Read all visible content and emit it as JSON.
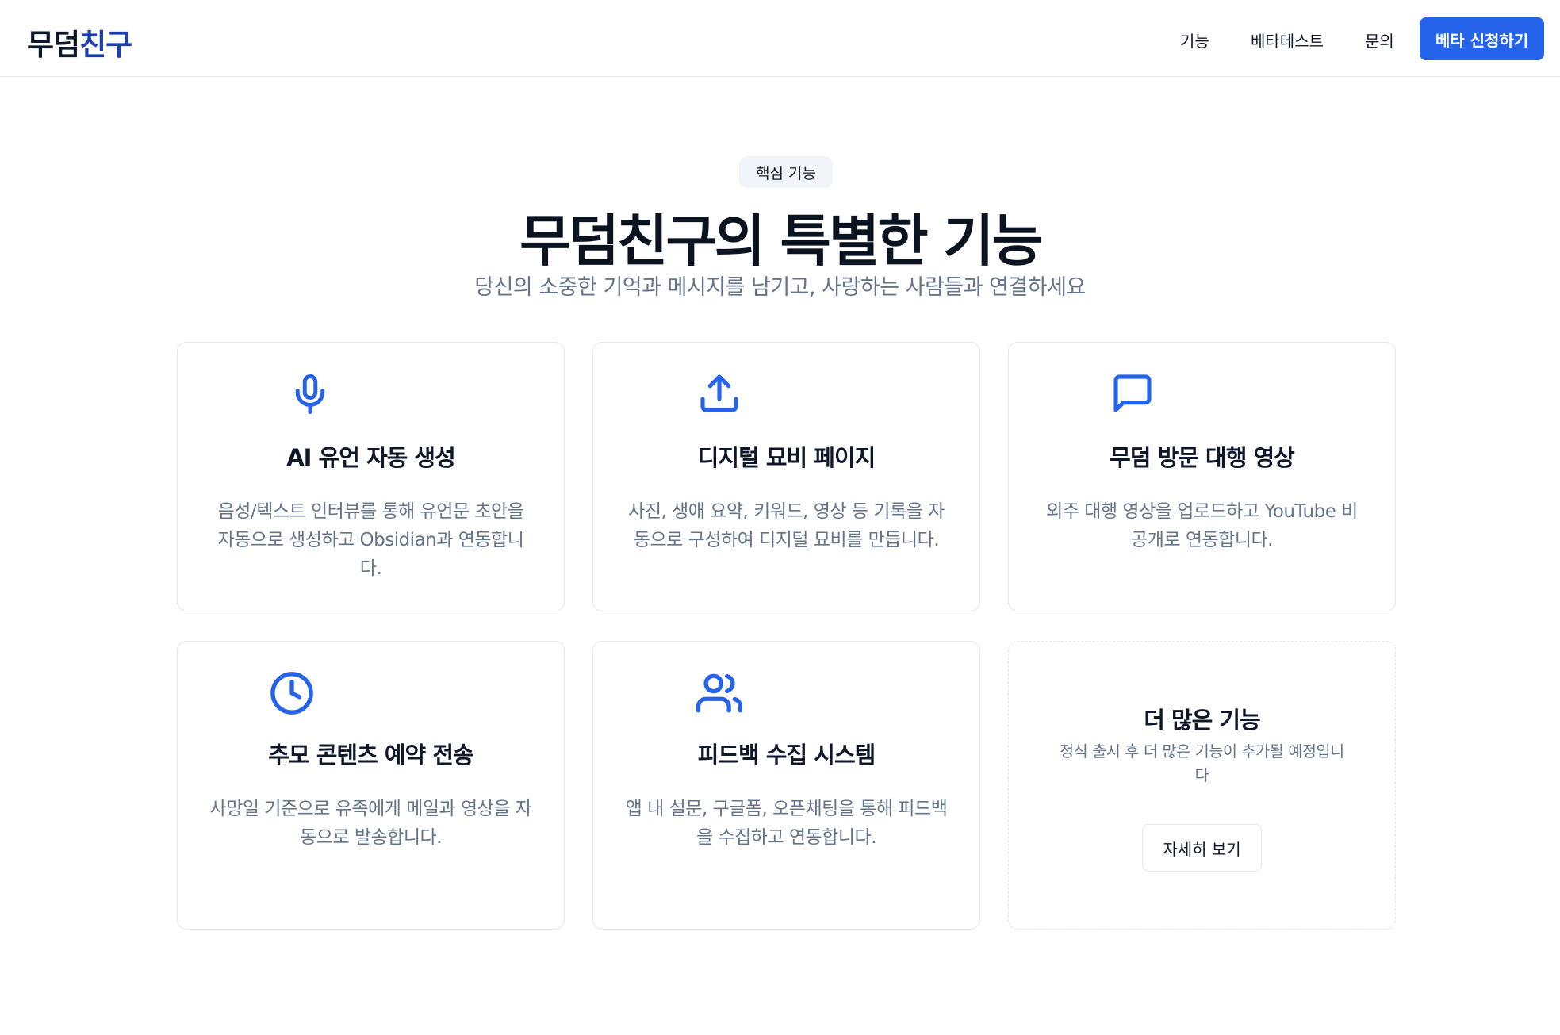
{
  "nav": {
    "brand_part1": "무덤",
    "brand_part2": "친구",
    "links": [
      "기능",
      "베타테스트",
      "문의"
    ],
    "cta_label": "베타 신청하기"
  },
  "section": {
    "badge": "핵심 기능",
    "title": "무덤친구의 특별한 기능",
    "subtitle": "당신의 소중한 기억과 메시지를 남기고, 사랑하는 사람들과 연결하세요"
  },
  "features": [
    {
      "icon": "microphone-icon",
      "title": "AI 유언 자동 생성",
      "desc": "음성/텍스트 인터뷰를 통해 유언문 초안을 자동으로 생성하고 Obsidian과 연동합니다."
    },
    {
      "icon": "upload-icon",
      "title": "디지털 묘비 페이지",
      "desc": "사진, 생애 요약, 키워드, 영상 등 기록을 자동으로 구성하여 디지털 묘비를 만듭니다."
    },
    {
      "icon": "message-square-icon",
      "title": "무덤 방문 대행 영상",
      "desc": "외주 대행 영상을 업로드하고 YouTube 비공개로 연동합니다."
    },
    {
      "icon": "clock-icon",
      "title": "추모 콘텐츠 예약 전송",
      "desc": "사망일 기준으로 유족에게 메일과 영상을 자동으로 발송합니다."
    },
    {
      "icon": "users-icon",
      "title": "피드백 수집 시스템",
      "desc": "앱 내 설문, 구글폼, 오픈채팅을 통해 피드백을 수집하고 연동합니다."
    }
  ],
  "more": {
    "title": "더 많은 기능",
    "desc": "정식 출시 후 더 많은 기능이 추가될 예정입니다",
    "button_label": "자세히 보기"
  },
  "colors": {
    "accent": "#2563eb",
    "brand_dark": "#1e40af",
    "muted_text": "#64748b",
    "border": "#e5e7eb"
  }
}
